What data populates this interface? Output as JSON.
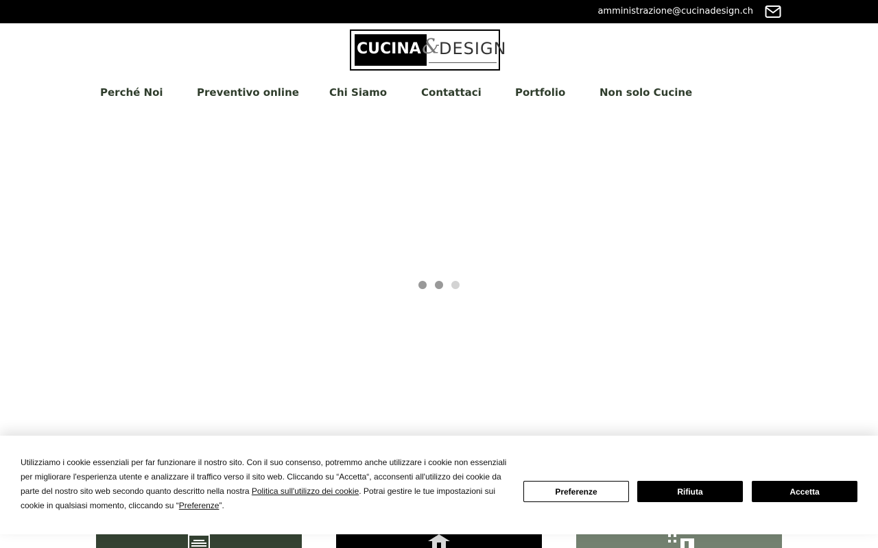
{
  "topbar": {
    "email": "amministrazione@cucinadesign.ch",
    "mail_icon": "envelope-icon"
  },
  "logo": {
    "word1": "CUCINA",
    "ampersand": "&",
    "word2": "DESIGN"
  },
  "nav": {
    "items": [
      {
        "label": "Perché Noi"
      },
      {
        "label": "Preventivo online"
      },
      {
        "label": "Chi Siamo"
      },
      {
        "label": "Contattaci"
      },
      {
        "label": "Portfolio"
      },
      {
        "label": "Non solo Cucine"
      }
    ]
  },
  "slider": {
    "dot_count": 3,
    "active_dots": [
      1,
      2
    ]
  },
  "tiles": {
    "colors": [
      "#344232",
      "#000000",
      "#738170"
    ],
    "icons": [
      "document-icon",
      "house-icon",
      "building-icon"
    ]
  },
  "cookie": {
    "text_1": "Utilizziamo i cookie essenziali per far funzionare il nostro sito. Con il suo consenso, potremmo anche utilizzare i cookie non essenziali per migliorare l'esperienza utente e analizzare il traffico verso il sito web. Cliccando su “Accetta“, acconsenti all'utilizzo dei cookie da parte del nostro sito web secondo quanto descritto nella nostra ",
    "policy_link": "Politica sull'utilizzo dei cookie",
    "text_2": ". Potrai gestire le tue impostazioni sui cookie in qualsiasi momento, cliccando su “",
    "pref_link": "Preferenze",
    "text_3": "”.",
    "buttons": {
      "preferences": "Preferenze",
      "reject": "Rifiuta",
      "accept": "Accetta"
    }
  },
  "colors": {
    "nav_text": "#2f3d2c",
    "dot_active": "#999999",
    "dot_inactive": "#d3d3d3"
  }
}
